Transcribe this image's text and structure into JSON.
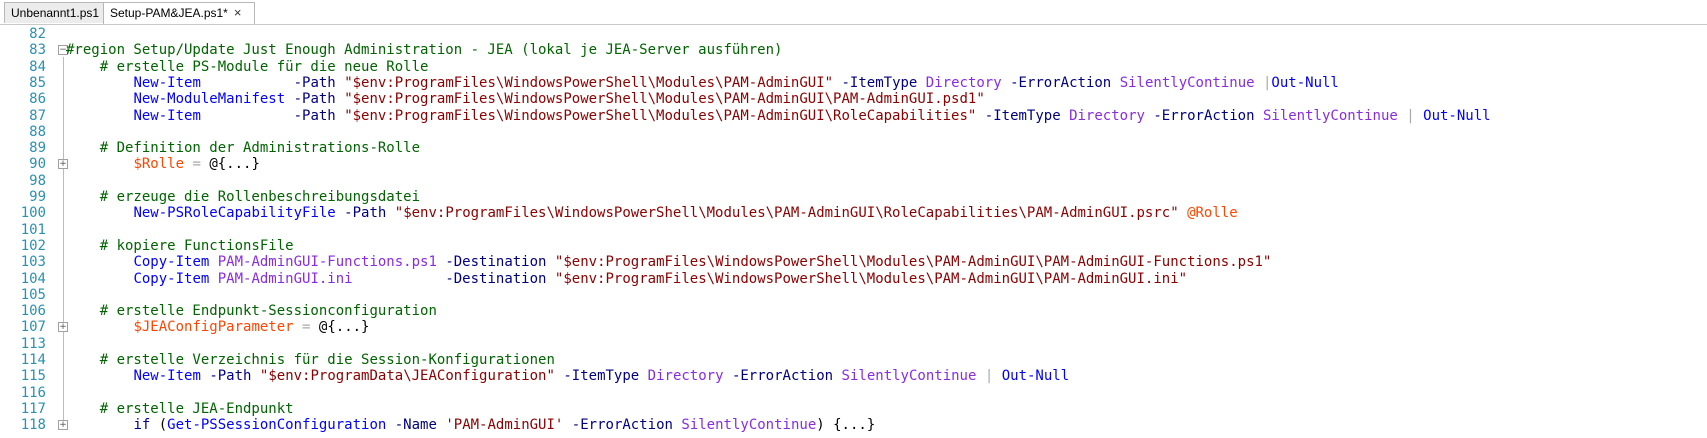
{
  "tabs": [
    {
      "label": "Unbenannt1.ps1",
      "active": false
    },
    {
      "label": "Setup-PAM&JEA.ps1*",
      "active": true,
      "close": "×"
    }
  ],
  "colors": {
    "line_number": "#2b91af",
    "comment": "#006400",
    "command": "#0000ff",
    "parameter": "#000080",
    "string": "#8b0000",
    "variable": "#ff4500",
    "value": "#8a2be2",
    "operator": "#a9a9a9"
  },
  "lines": [
    {
      "num": "82",
      "fold": "",
      "tokens": []
    },
    {
      "num": "83",
      "fold": "−",
      "tokens": [
        {
          "t": "comment",
          "v": "#region Setup/Update Just Enough Administration - JEA (lokal je JEA-Server ausführen)"
        }
      ]
    },
    {
      "num": "84",
      "fold": "",
      "tokens": [
        {
          "t": "text",
          "v": "    "
        },
        {
          "t": "comment",
          "v": "# erstelle PS-Module für die neue Rolle"
        }
      ]
    },
    {
      "num": "85",
      "fold": "",
      "tokens": [
        {
          "t": "text",
          "v": "        "
        },
        {
          "t": "cmd",
          "v": "New-Item"
        },
        {
          "t": "text",
          "v": "           "
        },
        {
          "t": "param",
          "v": "-Path"
        },
        {
          "t": "text",
          "v": " "
        },
        {
          "t": "string",
          "v": "\"$env:ProgramFiles\\WindowsPowerShell\\Modules\\PAM-AdminGUI\""
        },
        {
          "t": "text",
          "v": " "
        },
        {
          "t": "param",
          "v": "-ItemType"
        },
        {
          "t": "text",
          "v": " "
        },
        {
          "t": "value",
          "v": "Directory"
        },
        {
          "t": "text",
          "v": " "
        },
        {
          "t": "param",
          "v": "-ErrorAction"
        },
        {
          "t": "text",
          "v": " "
        },
        {
          "t": "value",
          "v": "SilentlyContinue"
        },
        {
          "t": "text",
          "v": " "
        },
        {
          "t": "op",
          "v": "|"
        },
        {
          "t": "cmd",
          "v": "Out-Null"
        }
      ]
    },
    {
      "num": "86",
      "fold": "",
      "tokens": [
        {
          "t": "text",
          "v": "        "
        },
        {
          "t": "cmd",
          "v": "New-ModuleManifest"
        },
        {
          "t": "text",
          "v": " "
        },
        {
          "t": "param",
          "v": "-Path"
        },
        {
          "t": "text",
          "v": " "
        },
        {
          "t": "string",
          "v": "\"$env:ProgramFiles\\WindowsPowerShell\\Modules\\PAM-AdminGUI\\PAM-AdminGUI.psd1\""
        }
      ]
    },
    {
      "num": "87",
      "fold": "",
      "tokens": [
        {
          "t": "text",
          "v": "        "
        },
        {
          "t": "cmd",
          "v": "New-Item"
        },
        {
          "t": "text",
          "v": "           "
        },
        {
          "t": "param",
          "v": "-Path"
        },
        {
          "t": "text",
          "v": " "
        },
        {
          "t": "string",
          "v": "\"$env:ProgramFiles\\WindowsPowerShell\\Modules\\PAM-AdminGUI\\RoleCapabilities\""
        },
        {
          "t": "text",
          "v": " "
        },
        {
          "t": "param",
          "v": "-ItemType"
        },
        {
          "t": "text",
          "v": " "
        },
        {
          "t": "value",
          "v": "Directory"
        },
        {
          "t": "text",
          "v": " "
        },
        {
          "t": "param",
          "v": "-ErrorAction"
        },
        {
          "t": "text",
          "v": " "
        },
        {
          "t": "value",
          "v": "SilentlyContinue"
        },
        {
          "t": "text",
          "v": " "
        },
        {
          "t": "op",
          "v": "|"
        },
        {
          "t": "text",
          "v": " "
        },
        {
          "t": "cmd",
          "v": "Out-Null"
        }
      ]
    },
    {
      "num": "88",
      "fold": "",
      "tokens": []
    },
    {
      "num": "89",
      "fold": "",
      "tokens": [
        {
          "t": "text",
          "v": "    "
        },
        {
          "t": "comment",
          "v": "# Definition der Administrations-Rolle"
        }
      ]
    },
    {
      "num": "90",
      "fold": "+",
      "tokens": [
        {
          "t": "text",
          "v": "        "
        },
        {
          "t": "var",
          "v": "$Rolle"
        },
        {
          "t": "text",
          "v": " "
        },
        {
          "t": "op",
          "v": "="
        },
        {
          "t": "text",
          "v": " "
        },
        {
          "t": "group",
          "v": "@{...}"
        }
      ]
    },
    {
      "num": "98",
      "fold": "",
      "tokens": []
    },
    {
      "num": "99",
      "fold": "",
      "tokens": [
        {
          "t": "text",
          "v": "    "
        },
        {
          "t": "comment",
          "v": "# erzeuge die Rollenbeschreibungsdatei"
        }
      ]
    },
    {
      "num": "100",
      "fold": "",
      "tokens": [
        {
          "t": "text",
          "v": "        "
        },
        {
          "t": "cmd",
          "v": "New-PSRoleCapabilityFile"
        },
        {
          "t": "text",
          "v": " "
        },
        {
          "t": "param",
          "v": "-Path"
        },
        {
          "t": "text",
          "v": " "
        },
        {
          "t": "string",
          "v": "\"$env:ProgramFiles\\WindowsPowerShell\\Modules\\PAM-AdminGUI\\RoleCapabilities\\PAM-AdminGUI.psrc\""
        },
        {
          "t": "text",
          "v": " "
        },
        {
          "t": "var",
          "v": "@Rolle"
        }
      ]
    },
    {
      "num": "101",
      "fold": "",
      "tokens": []
    },
    {
      "num": "102",
      "fold": "",
      "tokens": [
        {
          "t": "text",
          "v": "    "
        },
        {
          "t": "comment",
          "v": "# kopiere FunctionsFile"
        }
      ]
    },
    {
      "num": "103",
      "fold": "",
      "tokens": [
        {
          "t": "text",
          "v": "        "
        },
        {
          "t": "cmd",
          "v": "Copy-Item"
        },
        {
          "t": "text",
          "v": " "
        },
        {
          "t": "value",
          "v": "PAM-AdminGUI-Functions.ps1"
        },
        {
          "t": "text",
          "v": " "
        },
        {
          "t": "param",
          "v": "-Destination"
        },
        {
          "t": "text",
          "v": " "
        },
        {
          "t": "string",
          "v": "\"$env:ProgramFiles\\WindowsPowerShell\\Modules\\PAM-AdminGUI\\PAM-AdminGUI-Functions.ps1\""
        }
      ]
    },
    {
      "num": "104",
      "fold": "",
      "tokens": [
        {
          "t": "text",
          "v": "        "
        },
        {
          "t": "cmd",
          "v": "Copy-Item"
        },
        {
          "t": "text",
          "v": " "
        },
        {
          "t": "value",
          "v": "PAM-AdminGUI.ini"
        },
        {
          "t": "text",
          "v": "           "
        },
        {
          "t": "param",
          "v": "-Destination"
        },
        {
          "t": "text",
          "v": " "
        },
        {
          "t": "string",
          "v": "\"$env:ProgramFiles\\WindowsPowerShell\\Modules\\PAM-AdminGUI\\PAM-AdminGUI.ini\""
        }
      ]
    },
    {
      "num": "105",
      "fold": "",
      "tokens": []
    },
    {
      "num": "106",
      "fold": "",
      "tokens": [
        {
          "t": "text",
          "v": "    "
        },
        {
          "t": "comment",
          "v": "# erstelle Endpunkt-Sessionconfiguration"
        }
      ]
    },
    {
      "num": "107",
      "fold": "+",
      "tokens": [
        {
          "t": "text",
          "v": "        "
        },
        {
          "t": "var",
          "v": "$JEAConfigParameter"
        },
        {
          "t": "text",
          "v": " "
        },
        {
          "t": "op",
          "v": "="
        },
        {
          "t": "text",
          "v": " "
        },
        {
          "t": "group",
          "v": "@{...}"
        }
      ]
    },
    {
      "num": "113",
      "fold": "",
      "tokens": []
    },
    {
      "num": "114",
      "fold": "",
      "tokens": [
        {
          "t": "text",
          "v": "    "
        },
        {
          "t": "comment",
          "v": "# erstelle Verzeichnis für die Session-Konfigurationen"
        }
      ]
    },
    {
      "num": "115",
      "fold": "",
      "tokens": [
        {
          "t": "text",
          "v": "        "
        },
        {
          "t": "cmd",
          "v": "New-Item"
        },
        {
          "t": "text",
          "v": " "
        },
        {
          "t": "param",
          "v": "-Path"
        },
        {
          "t": "text",
          "v": " "
        },
        {
          "t": "string",
          "v": "\"$env:ProgramData\\JEAConfiguration\""
        },
        {
          "t": "text",
          "v": " "
        },
        {
          "t": "param",
          "v": "-ItemType"
        },
        {
          "t": "text",
          "v": " "
        },
        {
          "t": "value",
          "v": "Directory"
        },
        {
          "t": "text",
          "v": " "
        },
        {
          "t": "param",
          "v": "-ErrorAction"
        },
        {
          "t": "text",
          "v": " "
        },
        {
          "t": "value",
          "v": "SilentlyContinue"
        },
        {
          "t": "text",
          "v": " "
        },
        {
          "t": "op",
          "v": "|"
        },
        {
          "t": "text",
          "v": " "
        },
        {
          "t": "cmd",
          "v": "Out-Null"
        }
      ]
    },
    {
      "num": "116",
      "fold": "",
      "tokens": []
    },
    {
      "num": "117",
      "fold": "",
      "tokens": [
        {
          "t": "text",
          "v": "    "
        },
        {
          "t": "comment",
          "v": "# erstelle JEA-Endpunkt"
        }
      ]
    },
    {
      "num": "118",
      "fold": "+",
      "tokens": [
        {
          "t": "text",
          "v": "        "
        },
        {
          "t": "keyword",
          "v": "if"
        },
        {
          "t": "text",
          "v": " ("
        },
        {
          "t": "cmd",
          "v": "Get-PSSessionConfiguration"
        },
        {
          "t": "text",
          "v": " "
        },
        {
          "t": "param",
          "v": "-Name"
        },
        {
          "t": "text",
          "v": " "
        },
        {
          "t": "string",
          "v": "'PAM-AdminGUI'"
        },
        {
          "t": "text",
          "v": " "
        },
        {
          "t": "param",
          "v": "-ErrorAction"
        },
        {
          "t": "text",
          "v": " "
        },
        {
          "t": "value",
          "v": "SilentlyContinue"
        },
        {
          "t": "text",
          "v": ") {...}"
        }
      ]
    }
  ]
}
